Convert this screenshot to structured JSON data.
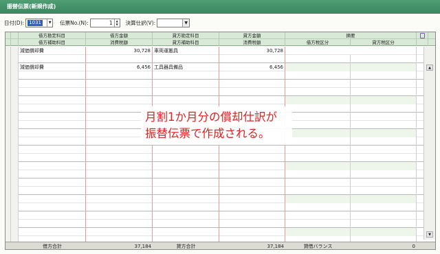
{
  "window": {
    "title": "振替伝票(新規作成)"
  },
  "toolbar": {
    "date_label": "日付(D):",
    "date_value": "1031",
    "denpyo_label": "伝票No.(N):",
    "denpyo_value": "1",
    "kessan_label": "決算仕訳(V):",
    "kessan_value": ""
  },
  "columns": {
    "header1": [
      "借方勘定科目",
      "借方金額",
      "貸方勘定科目",
      "貸方金額",
      "摘要"
    ],
    "header2": [
      "借方補助科目",
      "消費税額",
      "貸方補助科目",
      "消費税額",
      "借方税区分",
      "貸方税区分"
    ]
  },
  "rows": [
    {
      "debit_account": "減価償却費",
      "debit_amount": "30,728",
      "credit_account": "車両運搬具",
      "credit_amount": "30,728"
    },
    {
      "debit_account": "減価償却費",
      "debit_amount": "6,456",
      "credit_account": "工具器具備品",
      "credit_amount": "6,456"
    }
  ],
  "footer": {
    "debit_total_label": "借方合計",
    "debit_total": "37,184",
    "credit_total_label": "貸方合計",
    "credit_total": "37,184",
    "balance_label": "貸借バランス",
    "balance": "0"
  },
  "callout": {
    "line1": "月割1か月分の償却仕訳が",
    "line2": "振替伝票で作成される。"
  },
  "colors": {
    "title_bar": "#3f8c66",
    "header_bg": "#d8ead7",
    "callout_text": "#e02020"
  }
}
